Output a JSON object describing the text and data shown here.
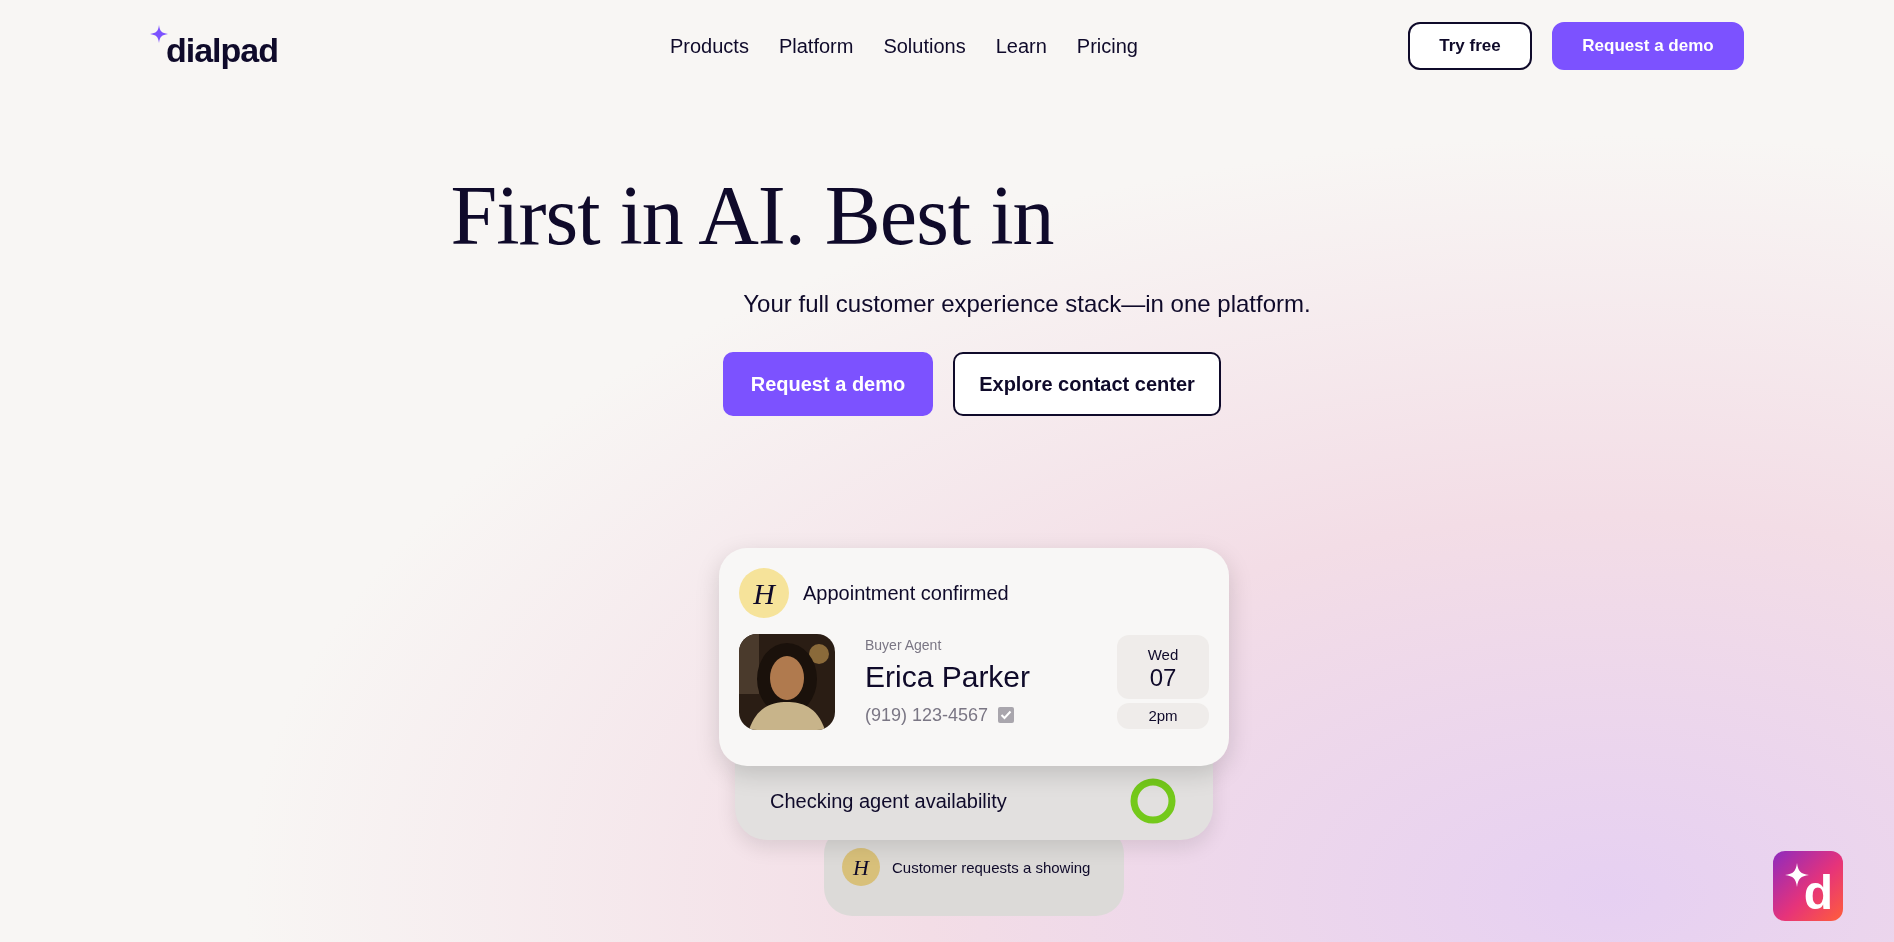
{
  "logo": {
    "text": "dialpad"
  },
  "nav": [
    {
      "label": "Products"
    },
    {
      "label": "Platform"
    },
    {
      "label": "Solutions"
    },
    {
      "label": "Learn"
    },
    {
      "label": "Pricing"
    }
  ],
  "header_buttons": [
    {
      "label": "Try free",
      "kind": "outline"
    },
    {
      "label": "Request a demo",
      "kind": "primary"
    }
  ],
  "hero": {
    "headline": "First in AI. Best in",
    "subtitle": "Your full customer experience stack—in one platform.",
    "buttons": [
      {
        "label": "Request a demo",
        "kind": "primary"
      },
      {
        "label": "Explore contact center",
        "kind": "outline"
      }
    ]
  },
  "cards": {
    "appointment": {
      "title": "Appointment confirmed",
      "avatar_letter": "H",
      "role": "Buyer Agent",
      "name": "Erica Parker",
      "phone": "(919) 123-4567",
      "verified": true,
      "day": "Wed",
      "date": "07",
      "time": "2pm"
    },
    "status": {
      "text": "Checking agent availability"
    },
    "request": {
      "avatar_letter": "H",
      "text": "Customer requests a showing"
    }
  },
  "chat_badge": {
    "letter": "d"
  }
}
